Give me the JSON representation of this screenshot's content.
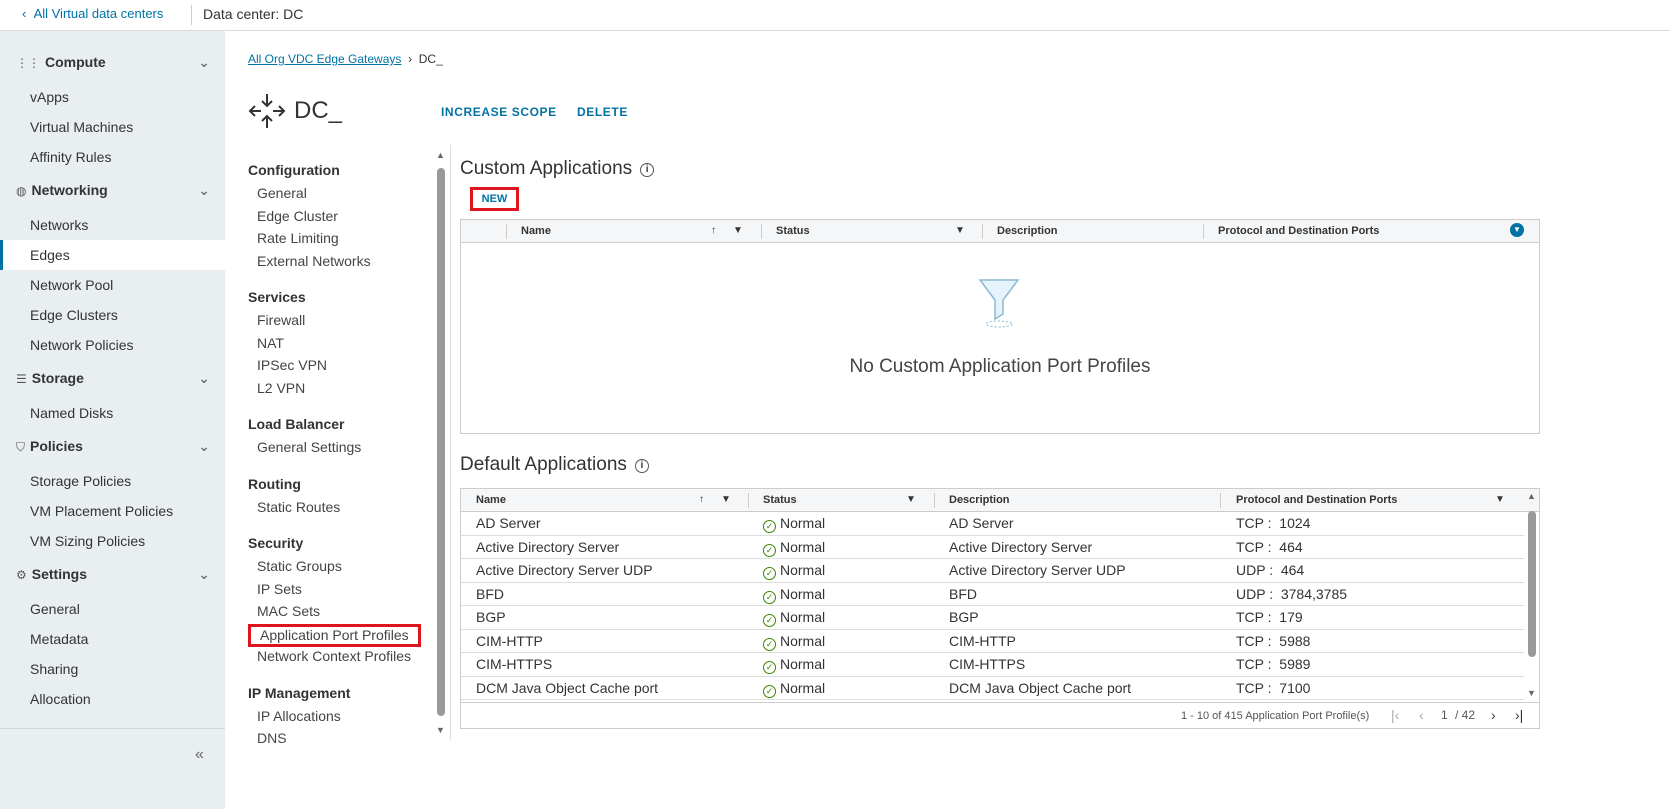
{
  "topbar": {
    "back_label": "All Virtual data centers",
    "datacenter_label": "Data center:",
    "datacenter_value": "DC"
  },
  "sidebar": {
    "sections": [
      {
        "label": "Compute",
        "icon": "grid-icon",
        "items": [
          "vApps",
          "Virtual Machines",
          "Affinity Rules"
        ]
      },
      {
        "label": "Networking",
        "icon": "network-icon",
        "items": [
          "Networks",
          "Edges",
          "Network Pool",
          "Edge Clusters",
          "Network Policies"
        ]
      },
      {
        "label": "Storage",
        "icon": "database-icon",
        "items": [
          "Named Disks"
        ]
      },
      {
        "label": "Policies",
        "icon": "shield-icon",
        "items": [
          "Storage Policies",
          "VM Placement Policies",
          "VM Sizing Policies"
        ]
      },
      {
        "label": "Settings",
        "icon": "gear-icon",
        "items": [
          "General",
          "Metadata",
          "Sharing",
          "Allocation"
        ]
      }
    ],
    "active_item": "Edges"
  },
  "breadcrumb": {
    "parent": "All Org VDC Edge Gateways",
    "current": "DC_"
  },
  "header": {
    "title": "DC_",
    "actions": [
      "INCREASE SCOPE",
      "DELETE"
    ]
  },
  "subnav": [
    {
      "group": "Configuration",
      "items": [
        "General",
        "Edge Cluster",
        "Rate Limiting",
        "External Networks"
      ]
    },
    {
      "group": "Services",
      "items": [
        "Firewall",
        "NAT",
        "IPSec VPN",
        "L2 VPN"
      ]
    },
    {
      "group": "Load Balancer",
      "items": [
        "General Settings"
      ]
    },
    {
      "group": "Routing",
      "items": [
        "Static Routes"
      ]
    },
    {
      "group": "Security",
      "items": [
        "Static Groups",
        "IP Sets",
        "MAC Sets",
        "Application Port Profiles",
        "Network Context Profiles"
      ]
    },
    {
      "group": "IP Management",
      "items": [
        "IP Allocations",
        "DNS"
      ]
    }
  ],
  "subnav_selected": "Application Port Profiles",
  "custom": {
    "title": "Custom Applications",
    "new_label": "NEW",
    "columns": [
      "Name",
      "Status",
      "Description",
      "Protocol and Destination Ports"
    ],
    "empty_message": "No Custom Application Port Profiles"
  },
  "default": {
    "title": "Default Applications",
    "columns": [
      "Name",
      "Status",
      "Description",
      "Protocol and Destination Ports"
    ],
    "rows": [
      [
        "AD Server",
        "Normal",
        "AD Server",
        "TCP :  1024"
      ],
      [
        "Active Directory Server",
        "Normal",
        "Active Directory Server",
        "TCP :  464"
      ],
      [
        "Active Directory Server UDP",
        "Normal",
        "Active Directory Server UDP",
        "UDP :  464"
      ],
      [
        "BFD",
        "Normal",
        "BFD",
        "UDP :  3784,3785"
      ],
      [
        "BGP",
        "Normal",
        "BGP",
        "TCP :  179"
      ],
      [
        "CIM-HTTP",
        "Normal",
        "CIM-HTTP",
        "TCP :  5988"
      ],
      [
        "CIM-HTTPS",
        "Normal",
        "CIM-HTTPS",
        "TCP :  5989"
      ],
      [
        "DCM Java Object Cache port",
        "Normal",
        "DCM Java Object Cache port",
        "TCP :  7100"
      ]
    ],
    "pagination": {
      "summary": "1 - 10 of 415 Application Port Profile(s)",
      "page": "1",
      "total": "/ 42"
    }
  },
  "colors": {
    "accent": "#0072a3",
    "highlight": "#e0141e",
    "status_ok": "#3c8500"
  }
}
